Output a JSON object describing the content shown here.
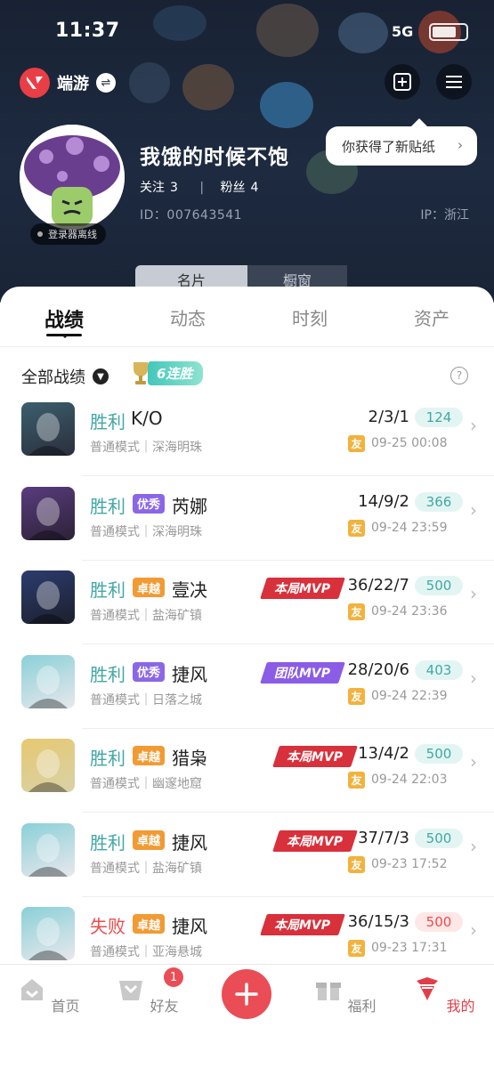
{
  "status": {
    "time": "11:37",
    "network": "5G"
  },
  "header": {
    "brand": "端游",
    "sticker_tip": "你获得了新贴纸",
    "username": "我饿的时候不饱",
    "follow_label": "关注",
    "follow_count": "3",
    "fans_label": "粉丝",
    "fans_count": "4",
    "id_text": "ID：007643541",
    "ip_text": "IP：浙江",
    "offline_text": "登录器离线",
    "card_tabs": [
      "名片",
      "橱窗"
    ]
  },
  "tabs": [
    "战绩",
    "动态",
    "时刻",
    "资产"
  ],
  "filter": {
    "label": "全部战绩",
    "streak": "6连胜"
  },
  "colors": {
    "accent": "#ea3e46",
    "win": "#41a8a4",
    "lose": "#ea4d4d",
    "level_excellent": "#8b67e6",
    "level_superior": "#f29a33",
    "mvp_match": "#d8313b",
    "mvp_team": "#8b5ce6",
    "score_bg_win": "#e3f5f3",
    "score_bg_lose": "#fde7e7",
    "friend_tag": "#f2b23e"
  },
  "matches": [
    {
      "result": "胜利",
      "level": "",
      "hero": "K/O",
      "mvp": "",
      "kda": "2/3/1",
      "score": "124",
      "mode": "普通模式｜深海明珠",
      "friend": "友",
      "time": "09-25 00:08",
      "win": true,
      "avatar": "ko-avatar-icon"
    },
    {
      "result": "胜利",
      "level": "优秀",
      "hero": "芮娜",
      "mvp": "",
      "kda": "14/9/2",
      "score": "366",
      "mode": "普通模式｜深海明珠",
      "friend": "友",
      "time": "09-24 23:59",
      "win": true,
      "avatar": "reyna-avatar-icon"
    },
    {
      "result": "胜利",
      "level": "卓越",
      "hero": "壹决",
      "mvp": "本局MVP",
      "kda": "36/22/7",
      "score": "500",
      "mode": "普通模式｜盐海矿镇",
      "friend": "友",
      "time": "09-24 23:36",
      "win": true,
      "avatar": "iso-avatar-icon"
    },
    {
      "result": "胜利",
      "level": "优秀",
      "hero": "捷风",
      "mvp": "团队MVP",
      "kda": "28/20/6",
      "score": "403",
      "mode": "普通模式｜日落之城",
      "friend": "友",
      "time": "09-24 22:39",
      "win": true,
      "avatar": "jett-avatar-icon"
    },
    {
      "result": "胜利",
      "level": "卓越",
      "hero": "猎枭",
      "mvp": "本局MVP",
      "kda": "13/4/2",
      "score": "500",
      "mode": "普通模式｜幽邃地窟",
      "friend": "友",
      "time": "09-24 22:03",
      "win": true,
      "avatar": "sova-avatar-icon"
    },
    {
      "result": "胜利",
      "level": "卓越",
      "hero": "捷风",
      "mvp": "本局MVP",
      "kda": "37/7/3",
      "score": "500",
      "mode": "普通模式｜盐海矿镇",
      "friend": "友",
      "time": "09-23 17:52",
      "win": true,
      "avatar": "jett-avatar-icon"
    },
    {
      "result": "失败",
      "level": "卓越",
      "hero": "捷风",
      "mvp": "本局MVP",
      "kda": "36/15/3",
      "score": "500",
      "mode": "普通模式｜亚海悬城",
      "friend": "友",
      "time": "09-23 17:31",
      "win": false,
      "avatar": "jett-avatar-icon"
    }
  ],
  "nav": [
    "首页",
    "好友",
    "福利",
    "我的"
  ],
  "nav_badge": "1"
}
